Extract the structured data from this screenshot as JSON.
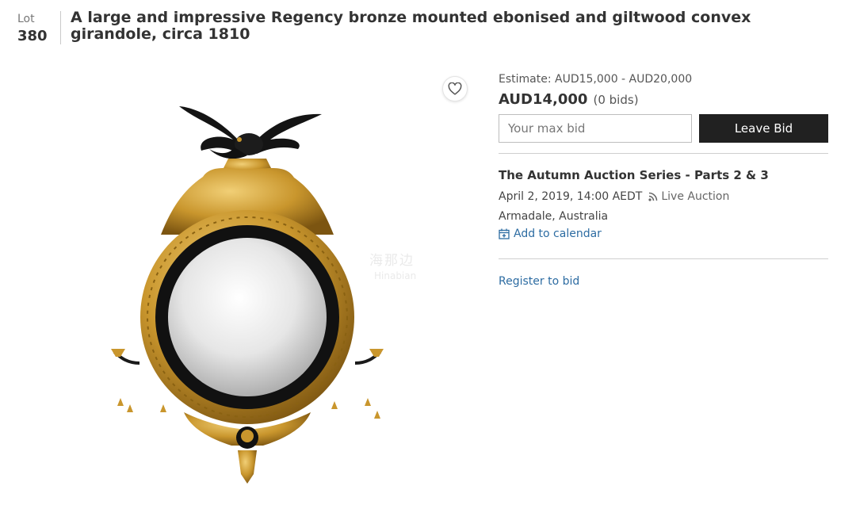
{
  "lot": {
    "label": "Lot",
    "number": "380"
  },
  "title": "A large and impressive Regency bronze mounted ebonised and giltwood convex girandole, circa 1810",
  "watermark": {
    "line1": "海那边",
    "line2": "Hinabian"
  },
  "bidding": {
    "estimate": "Estimate: AUD15,000 - AUD20,000",
    "current_price": "AUD14,000",
    "bids_count": "(0 bids)",
    "input_placeholder": "Your max bid",
    "button_label": "Leave Bid"
  },
  "sale": {
    "title": "The Autumn Auction Series - Parts 2 & 3",
    "datetime": "April 2, 2019, 14:00 AEDT",
    "type": "Live Auction",
    "location": "Armadale, Australia",
    "calendar_label": "Add to calendar"
  },
  "register_label": "Register to bid",
  "icons": {
    "favorite": "heart-icon",
    "live": "rss-icon",
    "calendar": "calendar-icon"
  },
  "colors": {
    "link": "#2d6ca2",
    "button_bg": "#212121",
    "gold": "#c9962d",
    "ebony": "#111111"
  }
}
